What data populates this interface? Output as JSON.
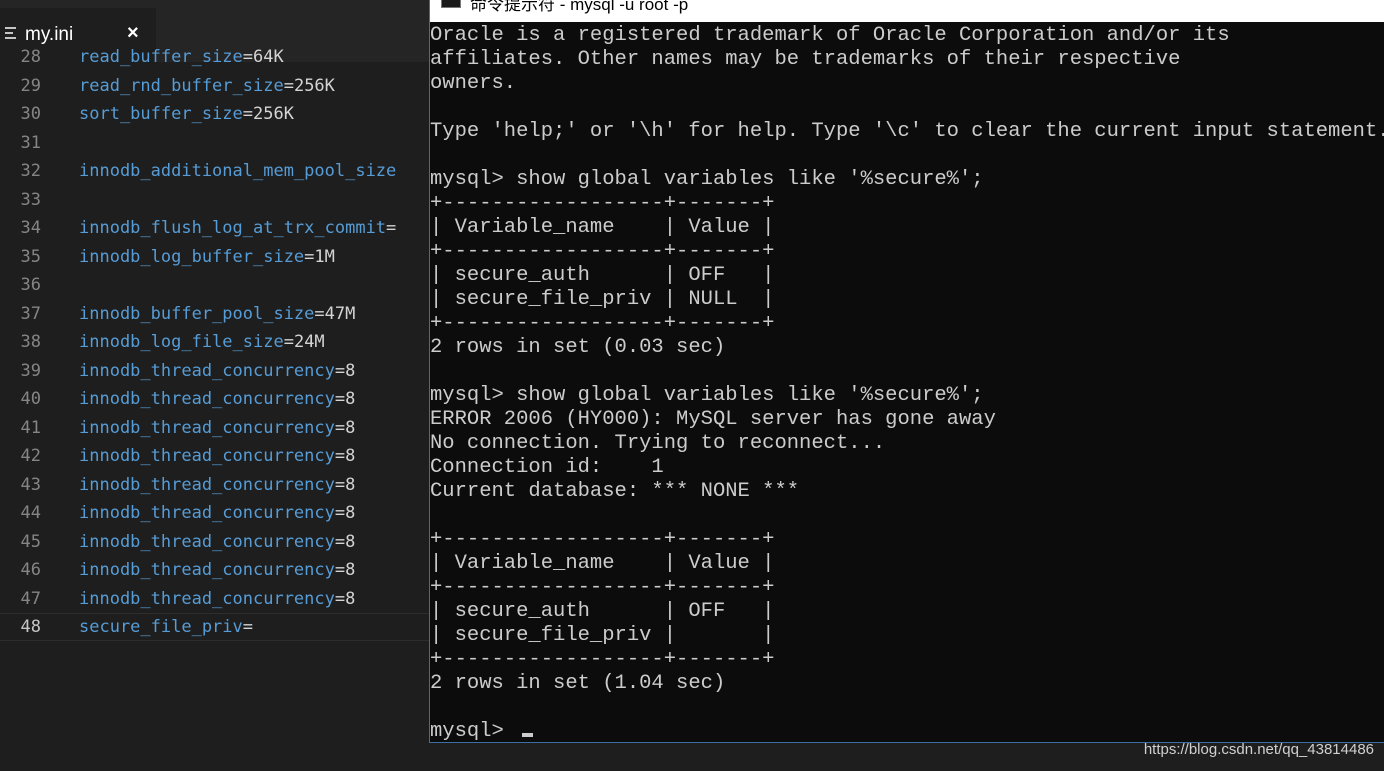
{
  "editor": {
    "tab": {
      "icon": "menu-lines-icon",
      "filename": "my.ini",
      "close": "×"
    },
    "lines": [
      {
        "num": "28",
        "key": "read_buffer_size",
        "op": "=",
        "val": "64K"
      },
      {
        "num": "29",
        "key": "read_rnd_buffer_size",
        "op": "=",
        "val": "256K"
      },
      {
        "num": "30",
        "key": "sort_buffer_size",
        "op": "=",
        "val": "256K"
      },
      {
        "num": "31",
        "key": "",
        "op": "",
        "val": ""
      },
      {
        "num": "32",
        "key": "innodb_additional_mem_pool_size",
        "op": "",
        "val": ""
      },
      {
        "num": "33",
        "key": "",
        "op": "",
        "val": ""
      },
      {
        "num": "34",
        "key": "innodb_flush_log_at_trx_commit",
        "op": "=",
        "val": ""
      },
      {
        "num": "35",
        "key": "innodb_log_buffer_size",
        "op": "=",
        "val": "1M"
      },
      {
        "num": "36",
        "key": "",
        "op": "",
        "val": ""
      },
      {
        "num": "37",
        "key": "innodb_buffer_pool_size",
        "op": "=",
        "val": "47M"
      },
      {
        "num": "38",
        "key": "innodb_log_file_size",
        "op": "=",
        "val": "24M"
      },
      {
        "num": "39",
        "key": "innodb_thread_concurrency",
        "op": "=",
        "val": "8"
      },
      {
        "num": "40",
        "key": "innodb_thread_concurrency",
        "op": "=",
        "val": "8"
      },
      {
        "num": "41",
        "key": "innodb_thread_concurrency",
        "op": "=",
        "val": "8"
      },
      {
        "num": "42",
        "key": "innodb_thread_concurrency",
        "op": "=",
        "val": "8"
      },
      {
        "num": "43",
        "key": "innodb_thread_concurrency",
        "op": "=",
        "val": "8"
      },
      {
        "num": "44",
        "key": "innodb_thread_concurrency",
        "op": "=",
        "val": "8"
      },
      {
        "num": "45",
        "key": "innodb_thread_concurrency",
        "op": "=",
        "val": "8"
      },
      {
        "num": "46",
        "key": "innodb_thread_concurrency",
        "op": "=",
        "val": "8"
      },
      {
        "num": "47",
        "key": "innodb_thread_concurrency",
        "op": "=",
        "val": "8"
      },
      {
        "num": "48",
        "key": "secure_file_priv",
        "op": "=",
        "val": ""
      }
    ]
  },
  "terminal": {
    "title": "命令提示符 - mysql -u root -p",
    "lines": [
      "Oracle is a registered trademark of Oracle Corporation and/or its",
      "affiliates. Other names may be trademarks of their respective",
      "owners.",
      "",
      "Type 'help;' or '\\h' for help. Type '\\c' to clear the current input statement.",
      "",
      "mysql> show global variables like '%secure%';",
      "+------------------+-------+",
      "| Variable_name    | Value |",
      "+------------------+-------+",
      "| secure_auth      | OFF   |",
      "| secure_file_priv | NULL  |",
      "+------------------+-------+",
      "2 rows in set (0.03 sec)",
      "",
      "mysql> show global variables like '%secure%';",
      "ERROR 2006 (HY000): MySQL server has gone away",
      "No connection. Trying to reconnect...",
      "Connection id:    1",
      "Current database: *** NONE ***",
      "",
      "+------------------+-------+",
      "| Variable_name    | Value |",
      "+------------------+-------+",
      "| secure_auth      | OFF   |",
      "| secure_file_priv |       |",
      "+------------------+-------+",
      "2 rows in set (1.04 sec)",
      "",
      "mysql> "
    ]
  },
  "watermark": "https://blog.csdn.net/qq_43814486",
  "colors": {
    "editor_bg": "#1e1e1e",
    "key": "#569cd6",
    "value": "#d4d4d4",
    "line_number": "#858585",
    "terminal_bg": "#0c0c0c",
    "terminal_text": "#cccccc"
  }
}
